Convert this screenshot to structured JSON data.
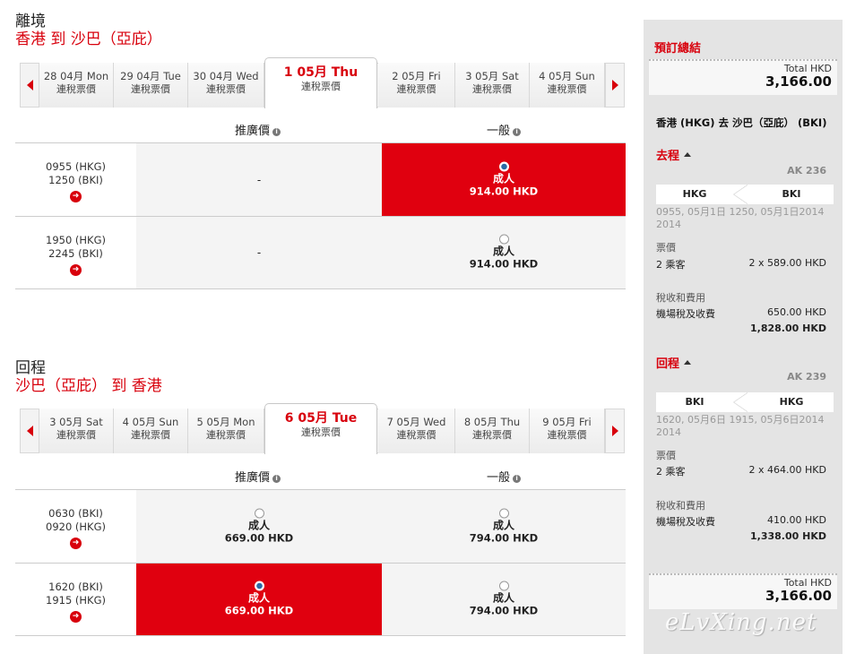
{
  "departure": {
    "title": "離境",
    "route": "香港 到 沙巴（亞庇）",
    "dates": [
      {
        "date": "28 04月 Mon",
        "sub": "連稅票價"
      },
      {
        "date": "29 04月 Tue",
        "sub": "連稅票價"
      },
      {
        "date": "30 04月 Wed",
        "sub": "連稅票價"
      },
      {
        "date": "1 05月 Thu",
        "sub": "連稅票價"
      },
      {
        "date": "2 05月 Fri",
        "sub": "連稅票價"
      },
      {
        "date": "3 05月 Sat",
        "sub": "連稅票價"
      },
      {
        "date": "4 05月 Sun",
        "sub": "連稅票價"
      }
    ],
    "col_promo": "推廣價",
    "col_normal": "一般",
    "flights": [
      {
        "dep": "0955 (HKG)",
        "arr": "1250 (BKI)",
        "promo": "-",
        "pax": "成人",
        "price": "914.00 HKD"
      },
      {
        "dep": "1950 (HKG)",
        "arr": "2245 (BKI)",
        "promo": "-",
        "pax": "成人",
        "price": "914.00 HKD"
      }
    ]
  },
  "return": {
    "title": "回程",
    "route": "沙巴（亞庇） 到 香港",
    "dates": [
      {
        "date": "3 05月 Sat",
        "sub": "連稅票價"
      },
      {
        "date": "4 05月 Sun",
        "sub": "連稅票價"
      },
      {
        "date": "5 05月 Mon",
        "sub": "連稅票價"
      },
      {
        "date": "6 05月 Tue",
        "sub": "連稅票價"
      },
      {
        "date": "7 05月 Wed",
        "sub": "連稅票價"
      },
      {
        "date": "8 05月 Thu",
        "sub": "連稅票價"
      },
      {
        "date": "9 05月 Fri",
        "sub": "連稅票價"
      }
    ],
    "col_promo": "推廣價",
    "col_normal": "一般",
    "flights": [
      {
        "dep": "0630 (BKI)",
        "arr": "0920 (HKG)",
        "promo_pax": "成人",
        "promo_price": "669.00 HKD",
        "pax": "成人",
        "price": "794.00 HKD"
      },
      {
        "dep": "1620 (BKI)",
        "arr": "1915 (HKG)",
        "promo_pax": "成人",
        "promo_price": "669.00 HKD",
        "pax": "成人",
        "price": "794.00 HKD"
      }
    ]
  },
  "summary": {
    "title": "預訂總結",
    "total_label": "Total HKD",
    "total_value": "3,166.00",
    "route": "香港 (HKG) 去 沙巴（亞庇） (BKI)",
    "outbound": {
      "label": "去程",
      "flight": "AK 236",
      "origin": "HKG",
      "dest": "BKI",
      "schedule": "0955, 05月1日 1250, 05月1日2014 2014",
      "fare_label": "票價",
      "pax_label": "2 乘客",
      "pax_value": "2 x 589.00 HKD",
      "tax_label": "稅收和費用",
      "tax_item": "機場稅及收費",
      "tax_value": "650.00 HKD",
      "subtotal": "1,828.00 HKD"
    },
    "inbound": {
      "label": "回程",
      "flight": "AK 239",
      "origin": "BKI",
      "dest": "HKG",
      "schedule": "1620, 05月6日 1915, 05月6日2014 2014",
      "fare_label": "票價",
      "pax_label": "2 乘客",
      "pax_value": "2 x 464.00 HKD",
      "tax_label": "稅收和費用",
      "tax_item": "機場稅及收費",
      "tax_value": "410.00 HKD",
      "subtotal": "1,338.00 HKD"
    },
    "total_label_bottom": "Total HKD",
    "total_value_bottom": "3,166.00"
  },
  "watermark": "eLvXing.net",
  "colors": {
    "accent": "#d8000c",
    "selected_bg": "#e0000f",
    "sidebar_bg": "#e4e4e4"
  },
  "icons": {
    "prev": "triangle-left",
    "next": "triangle-right",
    "info": "info-circle",
    "details": "arrow-circle-right",
    "collapse": "caret-up"
  }
}
